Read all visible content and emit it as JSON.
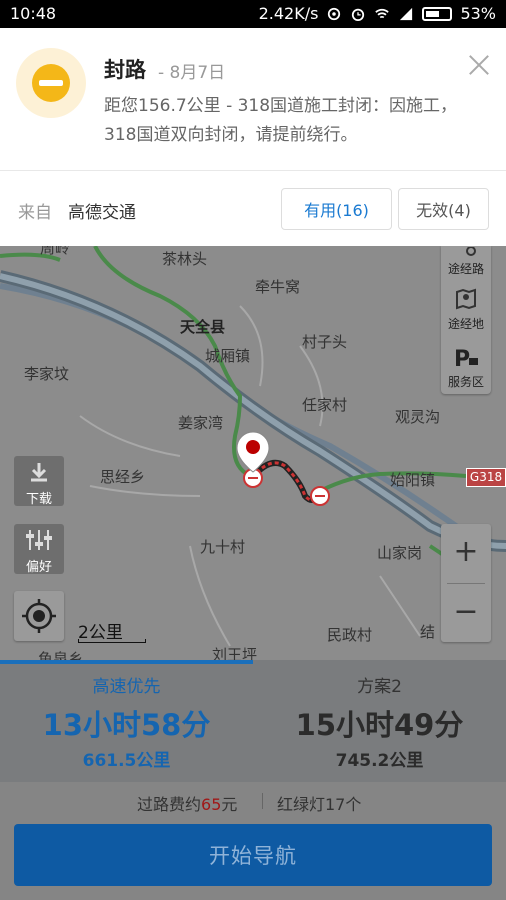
{
  "status_bar": {
    "time": "10:48",
    "network_speed": "2.42K/s",
    "battery": "53%"
  },
  "alert": {
    "title": "封路",
    "date": "- 8月7日",
    "message": "距您156.7公里 - 318国道施工封闭：因施工，318国道双向封闭，请提前绕行。",
    "source_label": "来自",
    "source_name": "高德交通",
    "useful_button": "有用(16)",
    "useless_button": "无效(4)"
  },
  "map": {
    "places": {
      "chalintou": "茶林头",
      "qianniuwo": "牵牛窝",
      "tianquan": "天全县",
      "chengxiang": "城厢镇",
      "cunzitou": "村子头",
      "lijiaba": "李家坟",
      "renjiacun": "任家村",
      "guanlinggou": "观灵沟",
      "jiangjiawan": "姜家湾",
      "sijingxiang": "思经乡",
      "shiyangzhen": "始阳镇",
      "jiushicun": "九十村",
      "shanjiagang": "山家岗",
      "minzhengcun": "民政村",
      "liuwangping": "刘王坪",
      "yuxixiang": "鱼泉乡",
      "jieshi": "结",
      "top_left_partial": "周岭"
    },
    "highway_shield": "G318",
    "side_panel": {
      "waypoint_route": "途经路",
      "waypoint_place": "途经地",
      "service_area": "服务区"
    },
    "download_label": "下载",
    "preference_label": "偏好",
    "zoom_in": "+",
    "zoom_out": "−",
    "scale": "2公里"
  },
  "routes": [
    {
      "name": "高速优先",
      "time": "13小时58分",
      "distance": "661.5公里"
    },
    {
      "name": "方案2",
      "time": "15小时49分",
      "distance": "745.2公里"
    }
  ],
  "fees": {
    "toll_prefix": "过路费约",
    "toll_amount": "65",
    "toll_suffix": "元",
    "traffic_lights": "红绿灯17个"
  },
  "start_button": "开始导航",
  "colors": {
    "accent_blue": "#1565b0",
    "warning_yellow": "#f4b718",
    "road_close_red": "#c33"
  }
}
